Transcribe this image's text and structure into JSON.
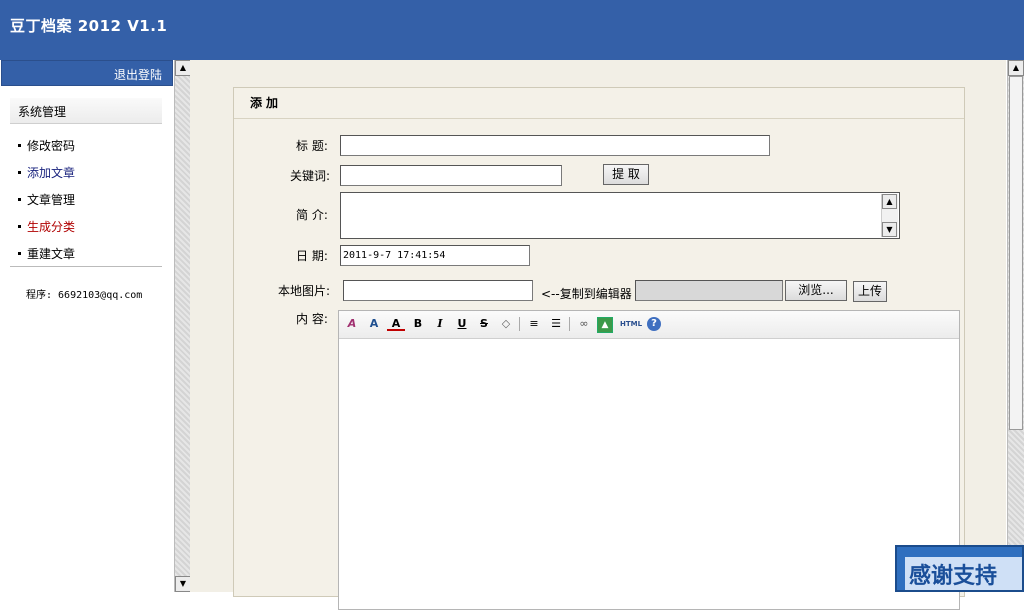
{
  "header": {
    "title": "豆丁档案 2012 V1.1"
  },
  "sidebar": {
    "logout": "退出登陆",
    "section_title": "系统管理",
    "items": [
      {
        "label": "修改密码",
        "color": "#000000"
      },
      {
        "label": "添加文章",
        "color": "#1a237e"
      },
      {
        "label": "文章管理",
        "color": "#000000"
      },
      {
        "label": "生成分类",
        "color": "#b00000"
      },
      {
        "label": "重建文章",
        "color": "#000000"
      }
    ],
    "credits": "程序: 6692103@qq.com"
  },
  "form": {
    "panel_title": "添加",
    "title_label": "标 题:",
    "title_value": "",
    "keyword_label": "关键词:",
    "keyword_value": "",
    "extract_button": "提 取",
    "summary_label": "简 介:",
    "summary_value": "",
    "date_label": "日 期:",
    "date_value": "2011-9-7 17:41:54",
    "image_label": "本地图片:",
    "image_value": "",
    "copy_hint": "<--复制到编辑器",
    "browse_button": "浏览...",
    "upload_button": "上传",
    "content_label": "内 容:"
  },
  "editor": {
    "tools": [
      "style-icon",
      "font-size-icon",
      "font-color-icon",
      "bold-icon",
      "italic-icon",
      "underline-icon",
      "strikethrough-icon",
      "eraser-icon",
      "align-icon",
      "list-icon",
      "link-icon",
      "image-icon",
      "html-icon",
      "help-icon"
    ],
    "html_label": "HTML"
  },
  "badge": {
    "text": "感谢支持"
  }
}
